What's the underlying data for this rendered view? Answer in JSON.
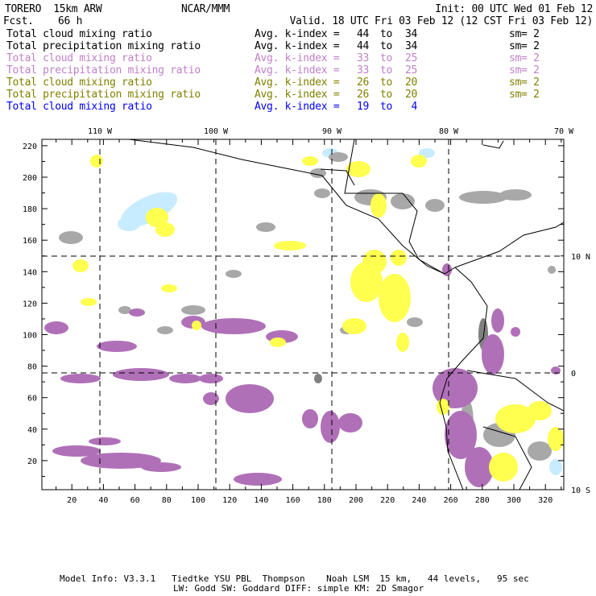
{
  "header": {
    "model": "TORERO  15km ARW",
    "center": "NCAR/MMM",
    "init": "Init: 00 UTC Wed 01 Feb 12",
    "fcst_label": "Fcst.",
    "fcst_value": "66 h",
    "valid": "Valid. 18 UTC Fri 03 Feb 12 (12 CST Fri 03 Feb 12)"
  },
  "legend": [
    {
      "label": "Total cloud mixing ratio",
      "avg": "Avg. k-index =",
      "from": "44",
      "to_word": "to",
      "to": "34",
      "sm": "sm= 2",
      "color": "#000000"
    },
    {
      "label": "Total precipitation mixing ratio",
      "avg": "Avg. k-index =",
      "from": "44",
      "to_word": "to",
      "to": "34",
      "sm": "sm= 2",
      "color": "#000000"
    },
    {
      "label": "Total cloud mixing ratio",
      "avg": "Avg. k-index =",
      "from": "33",
      "to_word": "to",
      "to": "25",
      "sm": "sm= 2",
      "color": "#c080c8"
    },
    {
      "label": "Total precipitation mixing ratio",
      "avg": "Avg. k-index =",
      "from": "33",
      "to_word": "to",
      "to": "25",
      "sm": "sm= 2",
      "color": "#c080c8"
    },
    {
      "label": "Total cloud mixing ratio",
      "avg": "Avg. k-index =",
      "from": "26",
      "to_word": "to",
      "to": "20",
      "sm": "sm= 2",
      "color": "#808000"
    },
    {
      "label": "Total precipitation mixing ratio",
      "avg": "Avg. k-index =",
      "from": "26",
      "to_word": "to",
      "to": "20",
      "sm": "sm= 2",
      "color": "#808000"
    },
    {
      "label": "Total cloud mixing ratio",
      "avg": "Avg. k-index =",
      "from": "19",
      "to_word": "to",
      "to": "4",
      "sm": "",
      "color": "#0000ff"
    }
  ],
  "map": {
    "lon_labels": [
      "110 W",
      "100 W",
      "90 W",
      "80 W",
      "70 W"
    ],
    "lat_labels": [
      "10 N",
      "0",
      "10 S"
    ],
    "x_ticks": [
      "20",
      "40",
      "60",
      "80",
      "100",
      "120",
      "140",
      "160",
      "180",
      "200",
      "220",
      "240",
      "260",
      "280",
      "300",
      "320"
    ],
    "y_ticks": [
      "20",
      "40",
      "60",
      "80",
      "100",
      "120",
      "140",
      "160",
      "180",
      "200",
      "220"
    ],
    "colors": {
      "purple": "#b070b8",
      "gray": "#a8a8a8",
      "yellow": "#ffff50",
      "lightblue": "#c8ecff"
    }
  },
  "footer": {
    "line1": "Model Info: V3.3.1   Tiedtke YSU PBL  Thompson    Noah LSM  15 km,   44 levels,   95 sec",
    "line2": "LW: Godd SW: Goddard DIFF: simple KM: 2D Smagor"
  }
}
